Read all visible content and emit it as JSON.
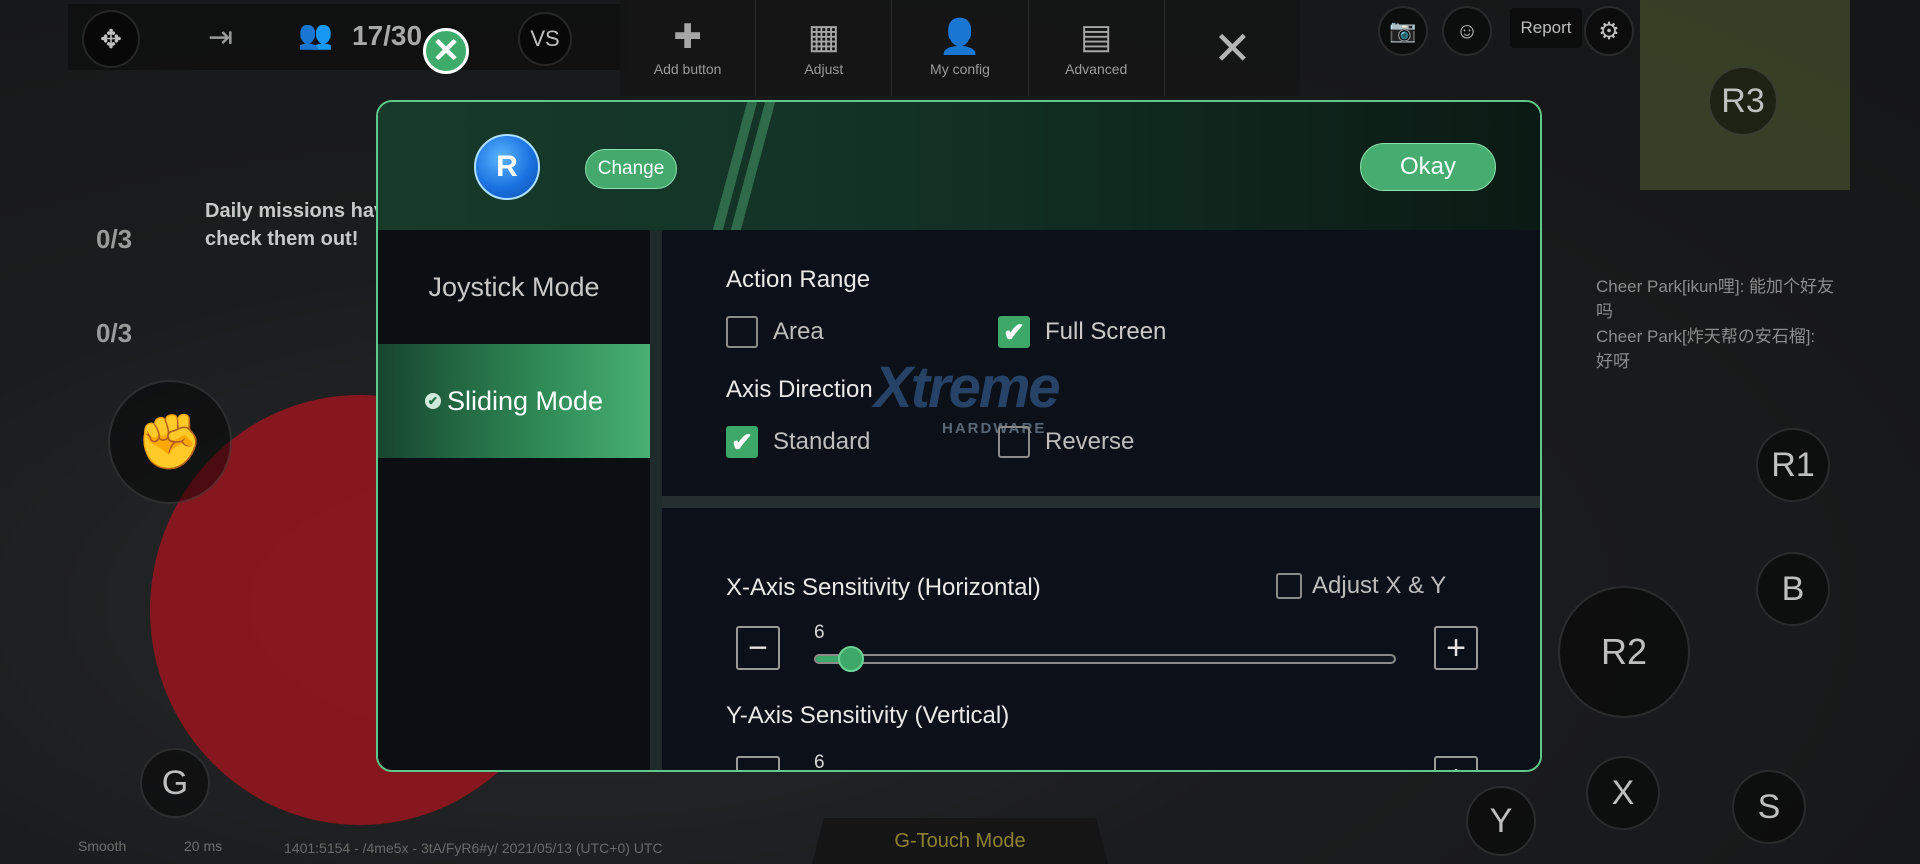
{
  "background": {
    "player_count": "17/30",
    "mission_text": "Daily missions have been updated, check them out!",
    "mission_line1": "Daily missions have b",
    "mission_line2": "check them out!",
    "count_a": "0/3",
    "count_b": "0/3",
    "report_label": "Report",
    "chat_line1": "Cheer Park[ikun哩]: 能加个好友吗",
    "chat_line2": "Cheer Park[炸天帮の安石榴]: 好呀",
    "status_text": "Smooth",
    "ping": "20 ms",
    "footer_info": "1401:5154 - /4me5x - 3tA/FyR6#y/  2021/05/13  (UTC+0) UTC",
    "buttons": {
      "r3": "R3",
      "r1": "R1",
      "b": "B",
      "r2": "R2",
      "x": "X",
      "s": "S",
      "y": "Y",
      "g": "G"
    },
    "gtouch_mode": "G-Touch Mode",
    "watermark_main": "Xtreme",
    "watermark_sub": "HARDWARE"
  },
  "toolbar": {
    "items": [
      {
        "label": "Add button",
        "icon": "plus-icon"
      },
      {
        "label": "Adjust",
        "icon": "grid-icon"
      },
      {
        "label": "My config",
        "icon": "user-icon"
      },
      {
        "label": "Advanced",
        "icon": "card-icon"
      }
    ],
    "close_icon": "close-icon"
  },
  "modal": {
    "avatar_letter": "R",
    "change_label": "Change",
    "okay_label": "Okay",
    "tabs": [
      {
        "label": "Joystick Mode",
        "active": false
      },
      {
        "label": "Sliding Mode",
        "active": true
      }
    ],
    "action_range": {
      "title": "Action Range",
      "options": [
        {
          "label": "Area",
          "checked": false
        },
        {
          "label": "Full Screen",
          "checked": true
        }
      ]
    },
    "axis_direction": {
      "title": "Axis Direction",
      "options": [
        {
          "label": "Standard",
          "checked": true
        },
        {
          "label": "Reverse",
          "checked": false
        }
      ]
    },
    "x_sensitivity": {
      "title": "X-Axis Sensitivity (Horizontal)",
      "value": "6",
      "fraction": 0.06
    },
    "adjust_xy": {
      "label": "Adjust X & Y",
      "checked": false
    },
    "y_sensitivity": {
      "title": "Y-Axis Sensitivity (Vertical)",
      "value": "6"
    }
  },
  "colors": {
    "accent": "#3ea869",
    "modal_border": "#5fc88a",
    "modal_bg": "#0d1118"
  }
}
